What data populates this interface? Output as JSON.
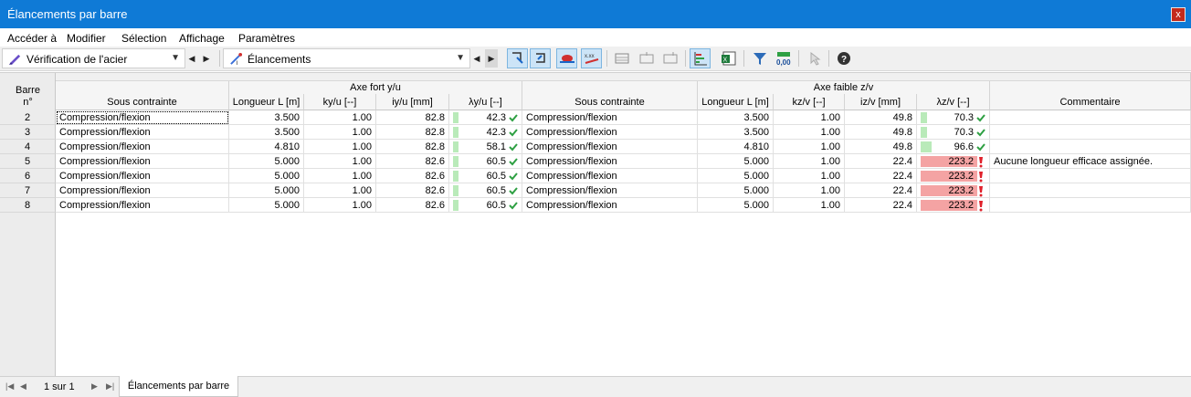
{
  "window": {
    "title": "Élancements par barre",
    "close_label": "x"
  },
  "menu": [
    "Accéder à",
    "Modifier",
    "Sélection",
    "Affichage",
    "Paramètres"
  ],
  "toolbar": {
    "module_combo": "Vérification de l'acier",
    "result_combo": "Élancements"
  },
  "headers": {
    "row_no_line1": "Barre",
    "row_no_line2": "n°",
    "strong_axis": "Axe fort y/u",
    "weak_axis": "Axe faible z/v",
    "constraint": "Sous contrainte",
    "length": "Longueur L [m]",
    "ky": "ky/u [--]",
    "iy": "iy/u [mm]",
    "lambda_y": "λy/u [--]",
    "constraint2": "Sous contrainte",
    "length2": "Longueur L [m]",
    "kz": "kz/v [--]",
    "iz": "iz/v [mm]",
    "lambda_z": "λz/v [--]",
    "comment": "Commentaire"
  },
  "rows": [
    {
      "no": "2",
      "c1": "Compression/flexion",
      "L1": "3.500",
      "k1": "1.00",
      "i1": "82.8",
      "lam1": "42.3",
      "lam1_fill": 0.07,
      "ok1": true,
      "c2": "Compression/flexion",
      "L2": "3.500",
      "k2": "1.00",
      "i2": "49.8",
      "lam2": "70.3",
      "lam2_fill": 0.12,
      "ok2": true,
      "comment": ""
    },
    {
      "no": "3",
      "c1": "Compression/flexion",
      "L1": "3.500",
      "k1": "1.00",
      "i1": "82.8",
      "lam1": "42.3",
      "lam1_fill": 0.07,
      "ok1": true,
      "c2": "Compression/flexion",
      "L2": "3.500",
      "k2": "1.00",
      "i2": "49.8",
      "lam2": "70.3",
      "lam2_fill": 0.12,
      "ok2": true,
      "comment": ""
    },
    {
      "no": "4",
      "c1": "Compression/flexion",
      "L1": "4.810",
      "k1": "1.00",
      "i1": "82.8",
      "lam1": "58.1",
      "lam1_fill": 0.07,
      "ok1": true,
      "c2": "Compression/flexion",
      "L2": "4.810",
      "k2": "1.00",
      "i2": "49.8",
      "lam2": "96.6",
      "lam2_fill": 0.2,
      "ok2": true,
      "comment": ""
    },
    {
      "no": "5",
      "c1": "Compression/flexion",
      "L1": "5.000",
      "k1": "1.00",
      "i1": "82.6",
      "lam1": "60.5",
      "lam1_fill": 0.07,
      "ok1": true,
      "c2": "Compression/flexion",
      "L2": "5.000",
      "k2": "1.00",
      "i2": "22.4",
      "lam2": "223.2",
      "lam2_fill": 1.0,
      "ok2": false,
      "comment": "Aucune longueur efficace assignée."
    },
    {
      "no": "6",
      "c1": "Compression/flexion",
      "L1": "5.000",
      "k1": "1.00",
      "i1": "82.6",
      "lam1": "60.5",
      "lam1_fill": 0.07,
      "ok1": true,
      "c2": "Compression/flexion",
      "L2": "5.000",
      "k2": "1.00",
      "i2": "22.4",
      "lam2": "223.2",
      "lam2_fill": 1.0,
      "ok2": false,
      "comment": ""
    },
    {
      "no": "7",
      "c1": "Compression/flexion",
      "L1": "5.000",
      "k1": "1.00",
      "i1": "82.6",
      "lam1": "60.5",
      "lam1_fill": 0.07,
      "ok1": true,
      "c2": "Compression/flexion",
      "L2": "5.000",
      "k2": "1.00",
      "i2": "22.4",
      "lam2": "223.2",
      "lam2_fill": 1.0,
      "ok2": false,
      "comment": ""
    },
    {
      "no": "8",
      "c1": "Compression/flexion",
      "L1": "5.000",
      "k1": "1.00",
      "i1": "82.6",
      "lam1": "60.5",
      "lam1_fill": 0.07,
      "ok1": true,
      "c2": "Compression/flexion",
      "L2": "5.000",
      "k2": "1.00",
      "i2": "22.4",
      "lam2": "223.2",
      "lam2_fill": 1.0,
      "ok2": false,
      "comment": ""
    }
  ],
  "footer": {
    "page": "1 sur 1",
    "tab": "Élancements par barre"
  },
  "colors": {
    "ok_bar": "#b9eab9",
    "fail_bar": "#f4a3a3",
    "ok_icon": "#2ea043",
    "fail_icon": "#e0202a",
    "titlebar": "#0f7ad6"
  }
}
